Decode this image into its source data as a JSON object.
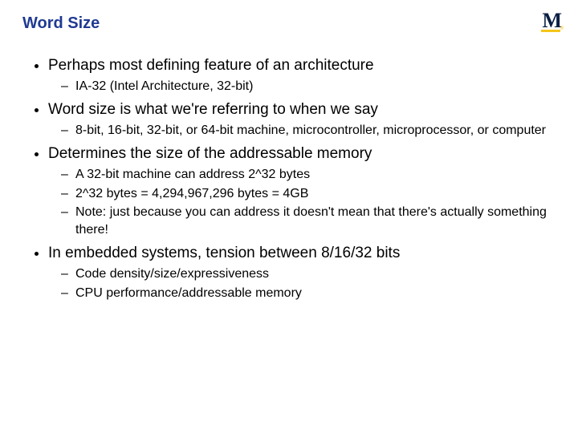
{
  "title": "Word Size",
  "logo": "M",
  "bullets": [
    {
      "text": "Perhaps most defining feature of an architecture",
      "sub": [
        "IA-32 (Intel Architecture, 32-bit)"
      ]
    },
    {
      "text": "Word size is what we're referring to when we say",
      "sub": [
        "8-bit, 16-bit, 32-bit, or 64-bit machine, microcontroller, microprocessor, or computer"
      ]
    },
    {
      "text": "Determines the size of the addressable memory",
      "sub": [
        "A 32-bit machine can address 2^32 bytes",
        "2^32 bytes = 4,294,967,296 bytes = 4GB",
        "Note: just because you can address it doesn't mean that there's actually something there!"
      ]
    },
    {
      "text": "In embedded systems, tension between 8/16/32 bits",
      "sub": [
        "Code density/size/expressiveness",
        "CPU performance/addressable memory"
      ]
    }
  ]
}
